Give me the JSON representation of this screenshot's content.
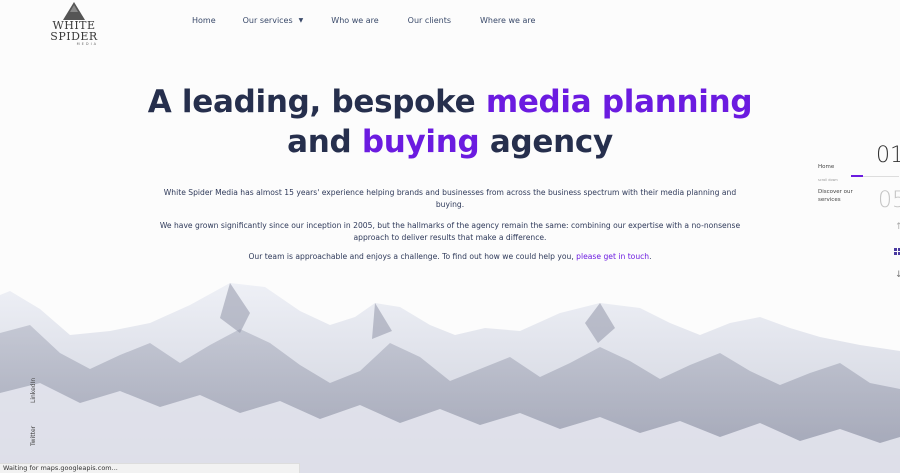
{
  "logo": {
    "line1": "WHITE",
    "line2": "SPIDER",
    "line3": "MEDIA"
  },
  "nav": {
    "home": "Home",
    "services": "Our services",
    "who": "Who we are",
    "clients": "Our clients",
    "where": "Where we are"
  },
  "hero": {
    "title_a": "A leading, bespoke ",
    "title_b": "media planning",
    "title_c": "and ",
    "title_d": "buying",
    "title_e": " agency",
    "p1": "White Spider Media has almost 15 years' experience helping brands and businesses from across the business spectrum with their media planning and buying.",
    "p2": "We have grown significantly since our inception in 2005, but the hallmarks of the agency remain the same: combining our expertise with a no-nonsense approach to deliver results that make a difference.",
    "p3": "Our team is approachable and enjoys a challenge. To find out how we could help you, ",
    "p3_link": "please get in touch",
    "p3_end": "."
  },
  "side": {
    "home": "Home",
    "scroll": "scroll down",
    "discover": "Discover our services",
    "num_current": "01",
    "num_total": "05"
  },
  "social": {
    "linkedin": "LinkedIn",
    "twitter": "Twitter"
  },
  "status": "Waiting for maps.googleapis.com...",
  "colors": {
    "accent": "#6b1be0",
    "heading": "#262f4d"
  }
}
